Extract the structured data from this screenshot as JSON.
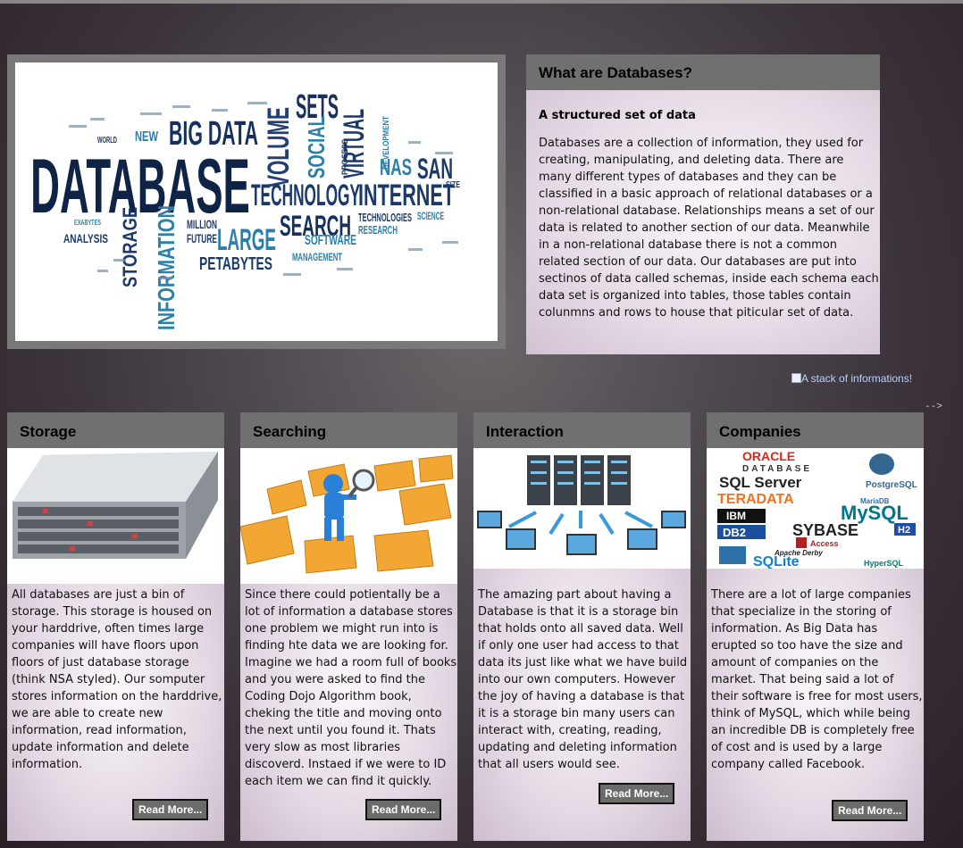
{
  "hero": {
    "words": [
      "DATABASE",
      "BIG DATA",
      "SETS",
      "VOLUME",
      "SOCIAL",
      "VIRTUAL",
      "TECHNOLOGY",
      "INTERNET",
      "NAS",
      "SAN",
      "SEARCH",
      "LARGE",
      "INFORMATION",
      "STORAGE",
      "ANALYSIS",
      "MILLION",
      "FUTURE",
      "PETABYTES",
      "SOFTWARE",
      "TECHNOLOGIES",
      "RESEARCH",
      "MANAGEMENT",
      "SCIENCE",
      "NEW",
      "WORLD",
      "EXABYTES",
      "SIZE",
      "DEVELOPMENT",
      "PROCESS"
    ]
  },
  "what": {
    "title": "What are Databases?",
    "subtitle": "A structured set of data",
    "text": "Databases are a collection of information, they used for creating, manipulating, and deleting data. There are many different types of databases and they can be classified in a basic approach of relational databases or a non-relational database. Relationships means a set of our data is related to another section of our data. Meanwhile in a non-relational database there is not a common related section of our data. Our databases are put into sectinos of data called schemas, inside each schema each data set is organized into tables, those tables contain colunmns and rows to house that piticular set of data."
  },
  "caption": "A stack of informations!",
  "arrow": "-->",
  "cards": [
    {
      "title": "Storage",
      "text": "All databases are just a bin of storage. This storage is housed on your harddrive, often times large companies will have floors upon floors of just database storage (think NSA styled). Our somputer stores information on the harddrive, we are able to create new information, read information, update information and delete information.",
      "button": "Read More..."
    },
    {
      "title": "Searching",
      "text": "Since there could potientally be a lot of information a database stores one problem we might run into is finding hte data we are looking for. Imagine we had a room full of books and you were asked to find the Coding Dojo Algorithm book, cheking the title and moving onto the next until you found it. Thats very slow as most libraries discoverd. Instaed if we were to ID each item we can find it quickly.",
      "button": "Read More..."
    },
    {
      "title": "Interaction",
      "text": "The amazing part about having a Database is that it is a storage bin that holds onto all saved data. Well if only one user had access to that data its just like what we have build into our own computers. However the joy of having a database is that it is a storage bin many users can interact with, creating, reading, updating and deleting information that all users would see.",
      "button": "Read More..."
    },
    {
      "title": "Companies",
      "text": "There are a lot of large companies that specialize in the storing of information. As Big Data has erupted so too have the size and amount of companies on the market. That being said a lot of their software is free for most users, think of MySQL, which while being an incredible DB is completely free of cost and is used by a large company called Facebook.",
      "button": "Read More..."
    }
  ],
  "logos": [
    "ORACLE",
    "DATABASE",
    "SQL Server",
    "PostgreSQL",
    "TERADATA",
    "MariaDB",
    "IBM",
    "DB2",
    "MySQL",
    "SYBASE",
    "H2",
    "Access",
    "Apache Derby",
    "SQLite",
    "HyperSQL"
  ],
  "colors": {
    "title_bar": "#717070",
    "accent_blue": "#1b3a6b",
    "caption": "#b9d0ff"
  }
}
